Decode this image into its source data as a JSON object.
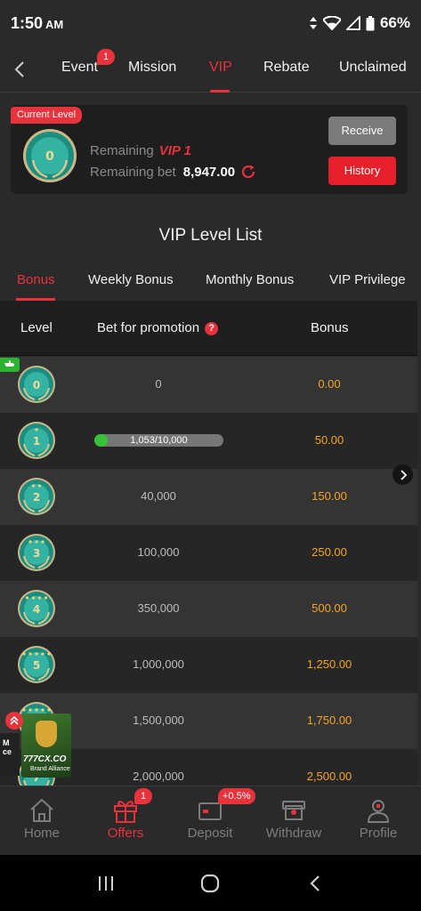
{
  "status_bar": {
    "time": "1:50",
    "ampm": "AM",
    "battery": "66%"
  },
  "top_tabs": [
    {
      "label": "Event"
    },
    {
      "label": "Mission"
    },
    {
      "label": "VIP"
    },
    {
      "label": "Rebate"
    },
    {
      "label": "Unclaimed"
    }
  ],
  "event_badge": "1",
  "current_level": {
    "tag": "Current Level",
    "medal_level": "0",
    "remaining_label": "Remaining",
    "remaining_vip": "VIP 1",
    "remaining_bet_label": "Remaining bet",
    "remaining_bet": "8,947.00",
    "receive_label": "Receive",
    "history_label": "History"
  },
  "list_title": "VIP Level List",
  "bonus_tabs": [
    {
      "label": "Bonus"
    },
    {
      "label": "Weekly Bonus"
    },
    {
      "label": "Monthly Bonus"
    },
    {
      "label": "VIP Privilege"
    }
  ],
  "table": {
    "headers": {
      "level": "Level",
      "bet": "Bet for promotion",
      "help": "?",
      "bonus": "Bonus"
    },
    "rows": [
      {
        "level": "0",
        "bet": "0",
        "bonus": "0.00"
      },
      {
        "level": "1",
        "bet": "",
        "progress_text": "1,053/10,000",
        "progress": 0.1053,
        "bonus": "50.00"
      },
      {
        "level": "2",
        "bet": "40,000",
        "bonus": "150.00"
      },
      {
        "level": "3",
        "bet": "100,000",
        "bonus": "250.00"
      },
      {
        "level": "4",
        "bet": "350,000",
        "bonus": "500.00"
      },
      {
        "level": "5",
        "bet": "1,000,000",
        "bonus": "1,250.00"
      },
      {
        "level": "6",
        "bet": "1,500,000",
        "bonus": "1,750.00"
      },
      {
        "level": "7",
        "bet": "2,000,000",
        "bonus": "2,500.00"
      }
    ]
  },
  "promo": {
    "brand": "777CX.CO",
    "subtitle": "Brand Alliance",
    "left_text": "M ce"
  },
  "bottom_nav": [
    {
      "label": "Home",
      "icon": "home-icon"
    },
    {
      "label": "Offers",
      "icon": "gift-icon"
    },
    {
      "label": "Deposit",
      "icon": "wallet-icon"
    },
    {
      "label": "Withdraw",
      "icon": "withdraw-icon"
    },
    {
      "label": "Profile",
      "icon": "profile-icon"
    }
  ],
  "offers_badge": "1",
  "deposit_badge": "+0.5%",
  "colors": {
    "accent": "#e8323c",
    "bonus": "#f5a623",
    "medal": "#1e9c8c",
    "progress": "#38c238"
  }
}
